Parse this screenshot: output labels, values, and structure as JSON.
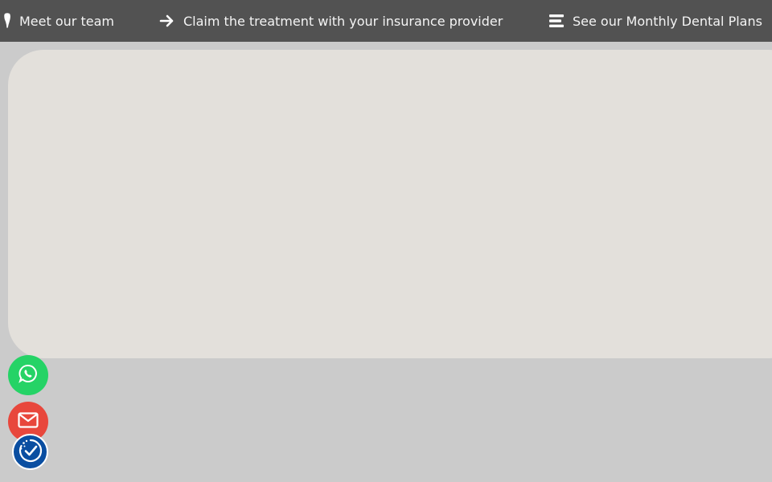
{
  "topbar": {
    "items": [
      {
        "label": "Meet our team",
        "icon": "tooth-icon"
      },
      {
        "label": "Claim the treatment with your insurance provider",
        "icon": "arrow-right-icon"
      },
      {
        "label": "See our Monthly Dental Plans",
        "icon": "menu-lines-icon"
      }
    ]
  },
  "floating_buttons": [
    {
      "name": "whatsapp",
      "icon": "whatsapp-icon",
      "color": "#25d366"
    },
    {
      "name": "email",
      "icon": "mail-icon",
      "color": "#e8473c"
    },
    {
      "name": "accessibility",
      "icon": "accessibility-check-icon",
      "color": "#0a4ea1"
    }
  ],
  "colors": {
    "topbar_bg": "#525252",
    "page_bg": "#cbcbcb",
    "card_bg": "#e3e0db"
  }
}
